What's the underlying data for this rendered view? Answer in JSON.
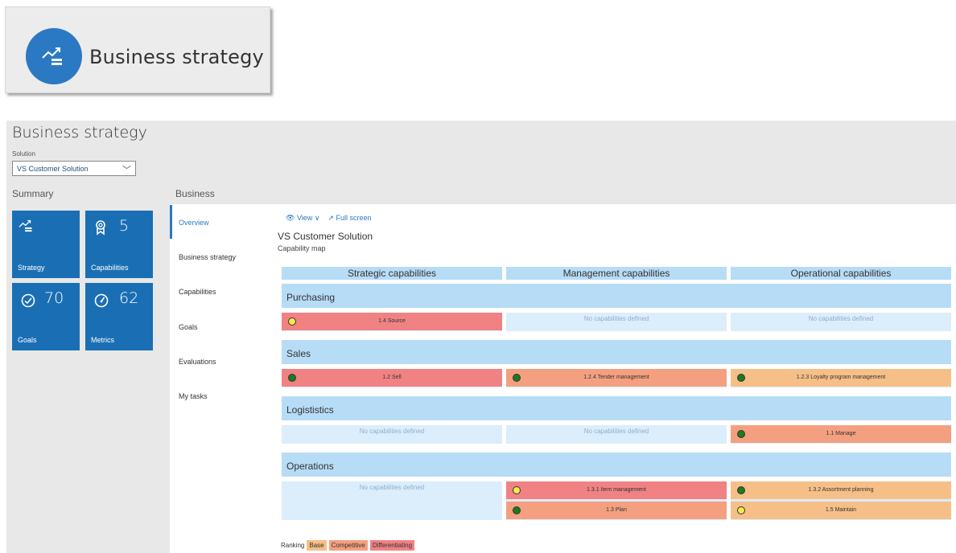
{
  "tile": {
    "label": "Business strategy",
    "icon": "trend-chart-icon"
  },
  "workspace": {
    "title": "Business strategy",
    "solution_label": "Solution",
    "solution_value": "VS Customer Solution",
    "summary_label": "Summary",
    "business_label": "Business"
  },
  "kpis": [
    {
      "caption": "Strategy",
      "number": "",
      "icon": "trend-chart-icon"
    },
    {
      "caption": "Capabilities",
      "number": "5",
      "icon": "ribbon-icon"
    },
    {
      "caption": "Goals",
      "number": "70",
      "icon": "checkmark-circle-icon"
    },
    {
      "caption": "Metrics",
      "number": "62",
      "icon": "gauge-icon"
    }
  ],
  "nav": {
    "items": [
      {
        "label": "Overview",
        "active": true
      },
      {
        "label": "Business strategy"
      },
      {
        "label": "Capabilities"
      },
      {
        "label": "Goals"
      },
      {
        "label": "Evaluations"
      },
      {
        "label": "My tasks"
      }
    ]
  },
  "toolbar": {
    "view_label": "View",
    "fullscreen_label": "Full screen"
  },
  "map": {
    "title": "VS Customer Solution",
    "subtitle": "Capability map",
    "columns": [
      "Strategic capabilities",
      "Management capabilities",
      "Operational capabilities"
    ],
    "empty_text": "No capabilities defined",
    "rows": [
      {
        "name": "Purchasing",
        "cells": [
          [
            {
              "label": "1.4 Source",
              "ranking": "Differentiating",
              "status": "yellow"
            }
          ],
          [],
          []
        ]
      },
      {
        "name": "Sales",
        "cells": [
          [
            {
              "label": "1.2 Sell",
              "ranking": "Differentiating",
              "status": "green"
            }
          ],
          [
            {
              "label": "1.2.4 Tender management",
              "ranking": "Competitive",
              "status": "green"
            }
          ],
          [
            {
              "label": "1.2.3 Loyalty program management",
              "ranking": "Base",
              "status": "green"
            }
          ]
        ]
      },
      {
        "name": "Logististics",
        "cells": [
          [],
          [],
          [
            {
              "label": "1.1 Manage",
              "ranking": "Competitive",
              "status": "green"
            }
          ]
        ]
      },
      {
        "name": "Operations",
        "cells": [
          [],
          [
            {
              "label": "1.3.1 Item management",
              "ranking": "Differentiating",
              "status": "yellow"
            },
            {
              "label": "1.3 Plan",
              "ranking": "Competitive",
              "status": "green"
            }
          ],
          [
            {
              "label": "1.3.2 Assortment planning",
              "ranking": "Base",
              "status": "green"
            },
            {
              "label": "1.5 Maintain",
              "ranking": "Base",
              "status": "yellow"
            }
          ]
        ]
      }
    ]
  },
  "legend": {
    "label": "Ranking",
    "items": [
      {
        "label": "Base",
        "color": "#f6bf88"
      },
      {
        "label": "Competitive",
        "color": "#f4a080"
      },
      {
        "label": "Differentiating",
        "color": "#f08284"
      }
    ]
  },
  "colors": {
    "accent": "#2b79c2",
    "tile_blue": "#1a6fb4",
    "header_blue": "#b7dcf6",
    "cell_blue": "#dcedfb"
  }
}
